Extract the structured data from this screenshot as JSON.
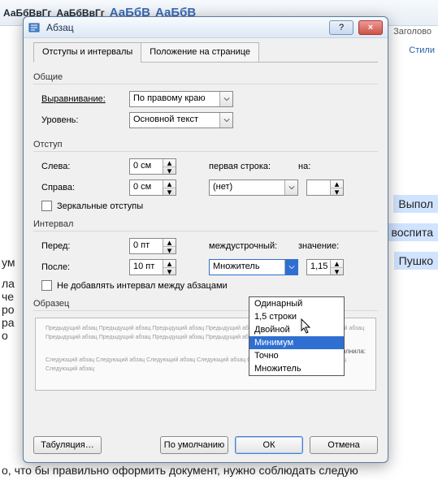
{
  "bg": {
    "style_samples": [
      "АаБбВвГг",
      "АаБбВвГг",
      "АаБбВ",
      "АаБбВ"
    ],
    "style_under": "Заголово",
    "styles_button": "Стили",
    "doc_left": [
      "ум",
      "ла",
      "че",
      "ро",
      "ра",
      "о"
    ],
    "highlights": [
      "Выпол",
      "воспита",
      "Пушко"
    ],
    "bottom_text": "о, что бы правильно оформить документ, нужно соблюдать следую"
  },
  "dialog": {
    "title": "Абзац",
    "help_tooltip": "?",
    "close_tooltip": "×",
    "tabs": {
      "tab1": "Отступы и интервалы",
      "tab2": "Положение на странице"
    },
    "sections": {
      "general": "Общие",
      "indent": "Отступ",
      "spacing": "Интервал",
      "sample": "Образец"
    },
    "fields": {
      "alignment_label": "Выравнивание:",
      "alignment_value": "По правому краю",
      "outline_label": "Уровень:",
      "outline_value": "Основной текст",
      "left_label": "Слева:",
      "left_value": "0 см",
      "right_label": "Справа:",
      "right_value": "0 см",
      "firstline_label": "первая строка:",
      "firstline_value": "(нет)",
      "by_label": "на:",
      "by_value": "",
      "mirror_label": "Зеркальные отступы",
      "before_label": "Перед:",
      "before_value": "0 пт",
      "after_label": "После:",
      "after_value": "10 пт",
      "linespc_label": "междустрочный:",
      "linespc_value": "Множитель",
      "value_label": "значение:",
      "value_value": "1,15",
      "no_space_label": "Не добавлять интервал между абзацами"
    },
    "dropdown_options": [
      "Одинарный",
      "1,5 строки",
      "Двойной",
      "Минимум",
      "Точно",
      "Множитель"
    ],
    "dropdown_selected_index": 3,
    "sample_text": {
      "prev": "Предыдущий абзац Предыдущий абзац Предыдущий абзац Предыдущий абзац Предыдущий абзац Предыдущий абзац Предыдущий абзац Предыдущий абзац Предыдущий абзац Предыдущий абзац",
      "mid": "Выполнила:",
      "next": "Следующий абзац Следующий абзац Следующий абзац Следующий абзац Следующий абзац Следующий абзац Следующий абзац"
    },
    "buttons": {
      "tabs_btn": "Табуляция…",
      "default_btn": "По умолчанию",
      "ok": "ОК",
      "cancel": "Отмена"
    }
  }
}
